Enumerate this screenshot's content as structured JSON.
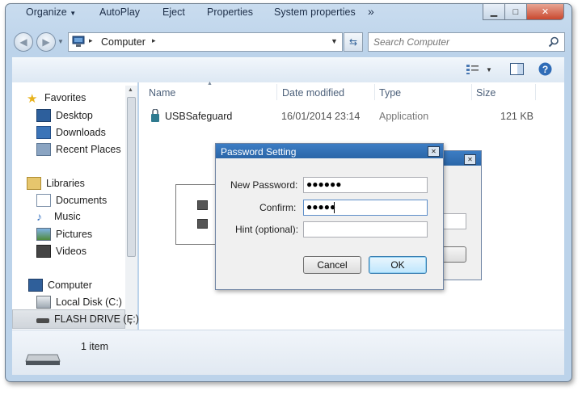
{
  "window": {
    "minimize_glyph": "▁",
    "maximize_glyph": "□",
    "close_glyph": "✕"
  },
  "address": {
    "root_label": "Computer",
    "separator": "▸"
  },
  "search": {
    "placeholder": "Search Computer"
  },
  "toolbar": {
    "items": [
      "Organize",
      "AutoPlay",
      "Eject",
      "Properties",
      "System properties"
    ],
    "more": "»"
  },
  "nav": {
    "favorites": {
      "label": "Favorites",
      "items": [
        "Desktop",
        "Downloads",
        "Recent Places"
      ]
    },
    "libraries": {
      "label": "Libraries",
      "items": [
        "Documents",
        "Music",
        "Pictures",
        "Videos"
      ]
    },
    "computer": {
      "label": "Computer",
      "items": [
        "Local Disk (C:)",
        "FLASH DRIVE (F:)"
      ]
    }
  },
  "columns": [
    "Name",
    "Date modified",
    "Type",
    "Size"
  ],
  "files": [
    {
      "name": "USBSafeguard",
      "date": "16/01/2014 23:14",
      "type": "Application",
      "size": "121 KB"
    }
  ],
  "details": {
    "count": "1 item"
  },
  "password_dialog": {
    "title": "Password Setting",
    "new_password_label": "New Password:",
    "confirm_label": "Confirm:",
    "hint_label": "Hint (optional):",
    "new_password_value": "●●●●●●",
    "confirm_value": "●●●●●",
    "hint_value": "",
    "cancel": "Cancel",
    "ok": "OK"
  },
  "colors": {
    "accent": "#2b66a8",
    "title_text": "#ffffff"
  }
}
